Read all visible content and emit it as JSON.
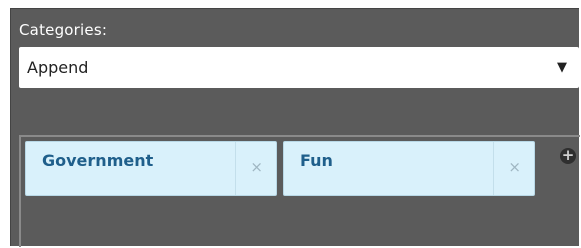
{
  "categories": {
    "label": "Categories:",
    "select_value": "Append",
    "caret": "▼"
  },
  "tags": [
    {
      "label": "Government",
      "remove": "×"
    },
    {
      "label": "Fun",
      "remove": "×"
    }
  ],
  "add_button": {
    "icon": "plus-circle-icon",
    "glyph": "+"
  }
}
